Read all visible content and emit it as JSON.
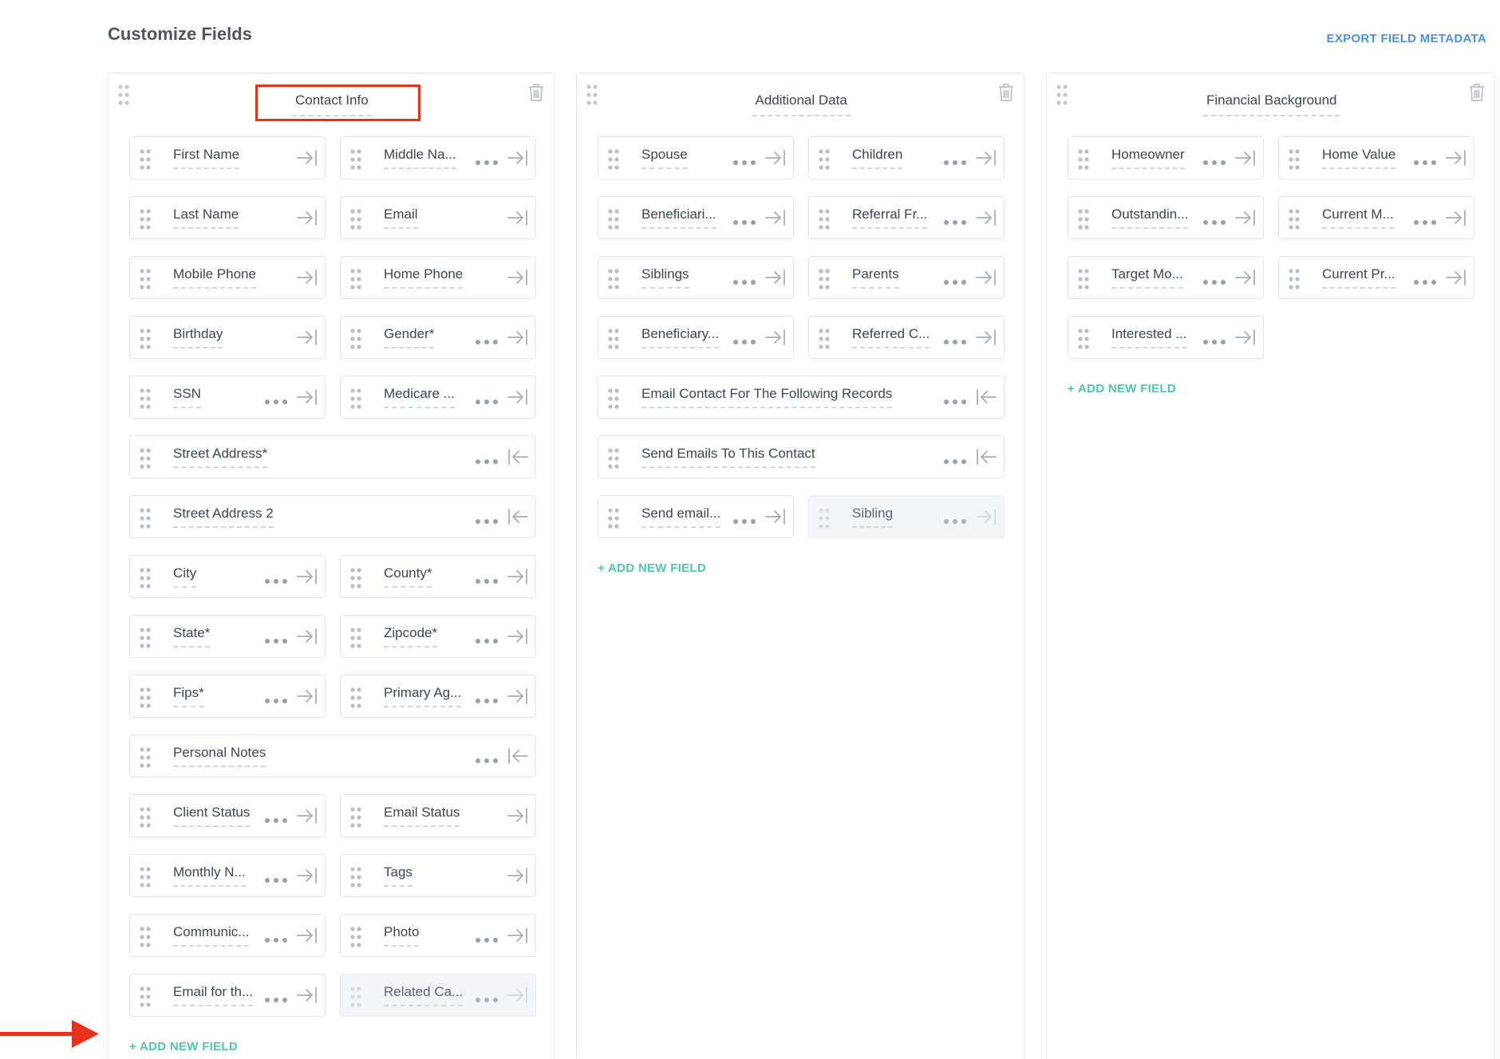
{
  "page": {
    "title": "Customize Fields",
    "export_label": "EXPORT FIELD METADATA"
  },
  "add_new_field_label": "+ ADD NEW FIELD",
  "colors": {
    "accent_blue": "#4a90e2",
    "add_green": "#4cc9a7",
    "annotation_red": "#e8311a"
  },
  "columns": [
    {
      "title": "Contact Info",
      "highlighted": true,
      "fields": [
        {
          "label": "First Name",
          "menu": false,
          "arrow": "right"
        },
        {
          "label": "Middle Na...",
          "menu": true,
          "arrow": "right"
        },
        {
          "label": "Last Name",
          "menu": false,
          "arrow": "right"
        },
        {
          "label": "Email",
          "menu": false,
          "arrow": "right"
        },
        {
          "label": "Mobile Phone",
          "menu": false,
          "arrow": "right"
        },
        {
          "label": "Home Phone",
          "menu": false,
          "arrow": "right"
        },
        {
          "label": "Birthday",
          "menu": false,
          "arrow": "right"
        },
        {
          "label": "Gender*",
          "menu": true,
          "arrow": "right"
        },
        {
          "label": "SSN",
          "menu": true,
          "arrow": "right"
        },
        {
          "label": "Medicare ...",
          "menu": true,
          "arrow": "right"
        },
        {
          "label": "Street Address*",
          "menu": true,
          "arrow": "left",
          "full": true
        },
        {
          "label": "Street Address 2",
          "menu": true,
          "arrow": "left",
          "full": true
        },
        {
          "label": "City",
          "menu": true,
          "arrow": "right"
        },
        {
          "label": "County*",
          "menu": true,
          "arrow": "right"
        },
        {
          "label": "State*",
          "menu": true,
          "arrow": "right"
        },
        {
          "label": "Zipcode*",
          "menu": true,
          "arrow": "right"
        },
        {
          "label": "Fips*",
          "menu": true,
          "arrow": "right"
        },
        {
          "label": "Primary Ag...",
          "menu": true,
          "arrow": "right"
        },
        {
          "label": "Personal Notes",
          "menu": true,
          "arrow": "left",
          "full": true
        },
        {
          "label": "Client Status",
          "menu": true,
          "arrow": "right"
        },
        {
          "label": "Email Status",
          "menu": false,
          "arrow": "right"
        },
        {
          "label": "Monthly N...",
          "menu": true,
          "arrow": "right"
        },
        {
          "label": "Tags",
          "menu": false,
          "arrow": "right"
        },
        {
          "label": "Communic...",
          "menu": true,
          "arrow": "right"
        },
        {
          "label": "Photo",
          "menu": true,
          "arrow": "right"
        },
        {
          "label": "Email for th...",
          "menu": true,
          "arrow": "right"
        },
        {
          "label": "Related Ca...",
          "menu": true,
          "arrow": "right",
          "ghost": true
        }
      ]
    },
    {
      "title": "Additional Data",
      "highlighted": false,
      "fields": [
        {
          "label": "Spouse",
          "menu": true,
          "arrow": "right"
        },
        {
          "label": "Children",
          "menu": true,
          "arrow": "right"
        },
        {
          "label": "Beneficiari...",
          "menu": true,
          "arrow": "right"
        },
        {
          "label": "Referral Fr...",
          "menu": true,
          "arrow": "right"
        },
        {
          "label": "Siblings",
          "menu": true,
          "arrow": "right"
        },
        {
          "label": "Parents",
          "menu": true,
          "arrow": "right"
        },
        {
          "label": "Beneficiary...",
          "menu": true,
          "arrow": "right"
        },
        {
          "label": "Referred C...",
          "menu": true,
          "arrow": "right"
        },
        {
          "label": "Email Contact For The Following Records",
          "menu": true,
          "arrow": "left",
          "full": true
        },
        {
          "label": "Send Emails To This Contact",
          "menu": true,
          "arrow": "left",
          "full": true
        },
        {
          "label": "Send email...",
          "menu": true,
          "arrow": "right"
        },
        {
          "label": "Sibling",
          "menu": true,
          "arrow": "right",
          "ghost": true
        }
      ]
    },
    {
      "title": "Financial Background",
      "highlighted": false,
      "fields": [
        {
          "label": "Homeowner",
          "menu": true,
          "arrow": "right"
        },
        {
          "label": "Home Value",
          "menu": true,
          "arrow": "right"
        },
        {
          "label": "Outstandin...",
          "menu": true,
          "arrow": "right"
        },
        {
          "label": "Current M...",
          "menu": true,
          "arrow": "right"
        },
        {
          "label": "Target Mo...",
          "menu": true,
          "arrow": "right"
        },
        {
          "label": "Current Pr...",
          "menu": true,
          "arrow": "right"
        },
        {
          "label": "Interested ...",
          "menu": true,
          "arrow": "right"
        }
      ]
    }
  ]
}
